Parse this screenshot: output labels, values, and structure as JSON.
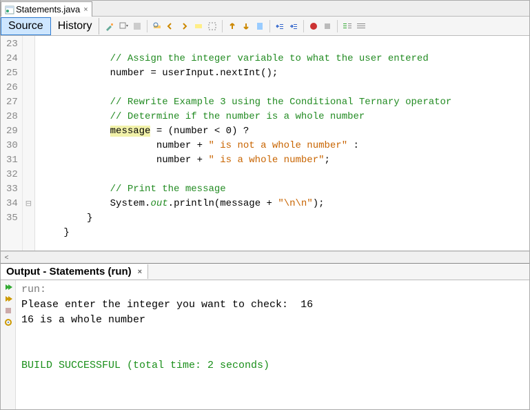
{
  "file_tab": {
    "title": "Statements.java"
  },
  "view_tabs": {
    "source": "Source",
    "history": "History"
  },
  "gutter": [
    "23",
    "24",
    "25",
    "26",
    "27",
    "28",
    "29",
    "30",
    "31",
    "32",
    "33",
    "34",
    "35"
  ],
  "code": {
    "l23": {
      "indent": "            ",
      "comment": "// Assign the integer variable to what the user entered"
    },
    "l24": {
      "indent": "            ",
      "text": "number = userInput.nextInt();"
    },
    "l25": {
      "indent": "            "
    },
    "l26": {
      "indent": "            ",
      "comment": "// Rewrite Example 3 using the Conditional Ternary operator"
    },
    "l27": {
      "indent": "            ",
      "comment": "// Determine if the number is a whole number"
    },
    "l28": {
      "indent": "            ",
      "hl": "message",
      "rest": " = (number < 0) ?"
    },
    "l29": {
      "indent": "                    ",
      "text": "number + ",
      "str": "\" is not a whole number\"",
      "tail": " :"
    },
    "l30": {
      "indent": "                    ",
      "text": "number + ",
      "str": "\" is a whole number\"",
      "tail": ";"
    },
    "l31": {
      "indent": "            "
    },
    "l32": {
      "indent": "            ",
      "comment": "// Print the message"
    },
    "l33": {
      "indent": "            ",
      "pre": "System.",
      "field": "out",
      "mid": ".println(message + ",
      "str": "\"\\n\\n\"",
      "tail": ");"
    },
    "l34": {
      "indent": "        ",
      "text": "}"
    },
    "l35": {
      "indent": "    ",
      "text": "}"
    }
  },
  "output": {
    "title": "Output - Statements (run)",
    "lines": {
      "run": "run:",
      "prompt": "Please enter the integer you want to check:  16",
      "result": "16 is a whole number",
      "blank": "",
      "blank2": "",
      "build": "BUILD SUCCESSFUL (total time: 2 seconds)"
    }
  }
}
